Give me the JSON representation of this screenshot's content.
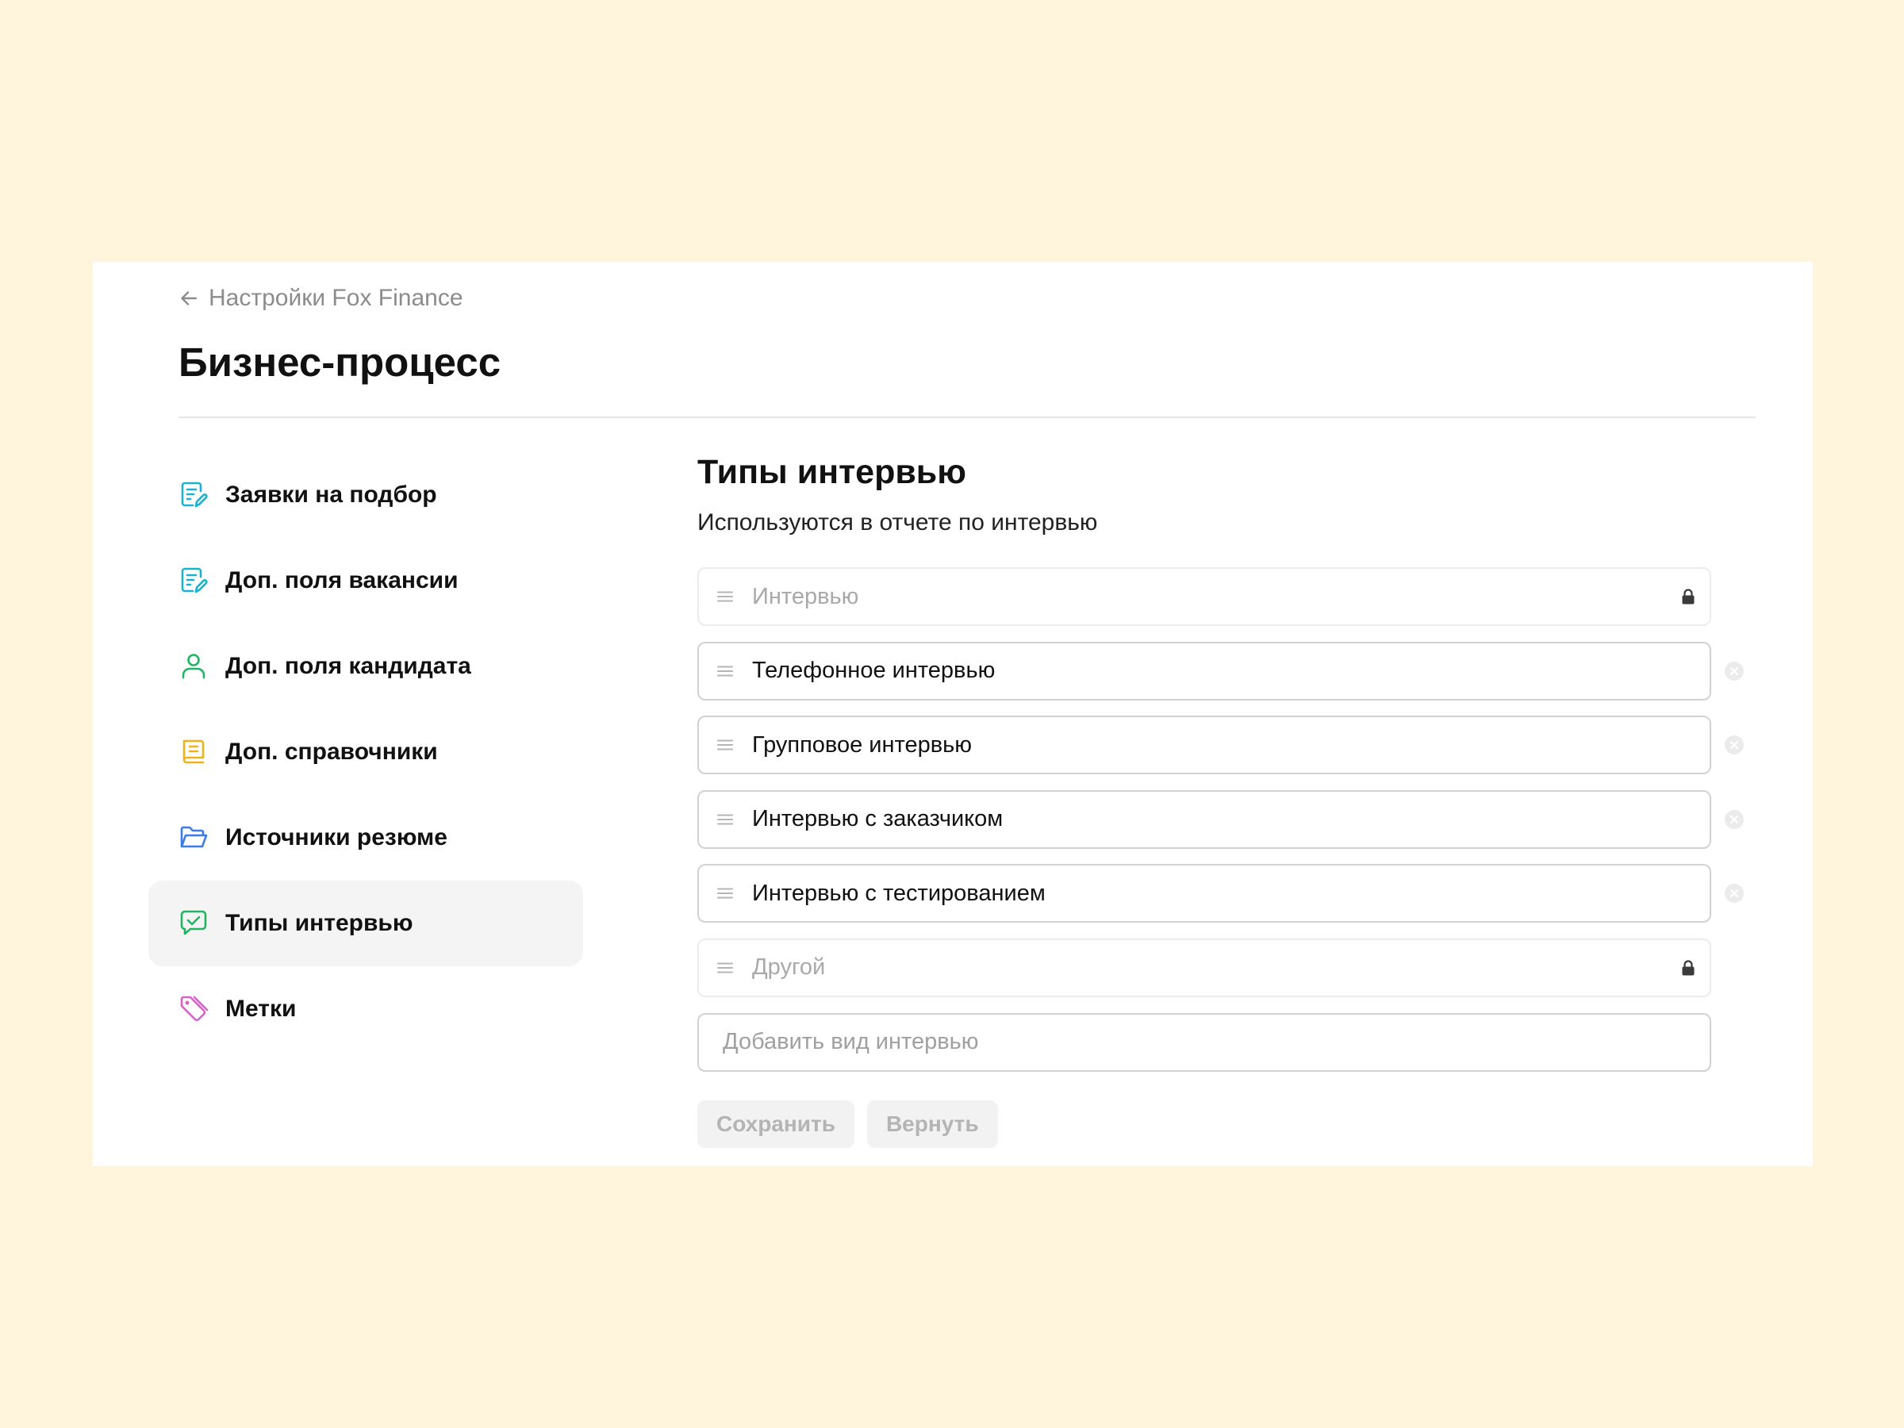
{
  "breadcrumb": {
    "label": "Настройки Fox Finance",
    "icon": "arrow-left-icon"
  },
  "page": {
    "title": "Бизнес-процесс"
  },
  "sidebar": {
    "items": [
      {
        "label": "Заявки на подбор",
        "icon": "document-edit-icon",
        "color": "#1ab3cf",
        "active": false
      },
      {
        "label": "Доп. поля вакансии",
        "icon": "document-edit-icon",
        "color": "#1ab3cf",
        "active": false
      },
      {
        "label": "Доп. поля кандидата",
        "icon": "user-icon",
        "color": "#21b462",
        "active": false
      },
      {
        "label": "Доп. справочники",
        "icon": "list-book-icon",
        "color": "#f0b11a",
        "active": false
      },
      {
        "label": "Источники резюме",
        "icon": "folder-icon",
        "color": "#3b7be8",
        "active": false
      },
      {
        "label": "Типы интервью",
        "icon": "chat-check-icon",
        "color": "#21b462",
        "active": true
      },
      {
        "label": "Метки",
        "icon": "tag-icon",
        "color": "#d562c8",
        "active": false
      }
    ]
  },
  "content": {
    "title": "Типы интервью",
    "subtitle": "Используются в отчете по интервью",
    "items": [
      {
        "value": "Интервью",
        "locked": true
      },
      {
        "value": "Телефонное интервью",
        "locked": false
      },
      {
        "value": "Групповое интервью",
        "locked": false
      },
      {
        "value": "Интервью с заказчиком",
        "locked": false
      },
      {
        "value": "Интервью с тестированием",
        "locked": false
      },
      {
        "value": "Другой",
        "locked": true
      }
    ],
    "add_placeholder": "Добавить вид интервью",
    "save_label": "Сохранить",
    "revert_label": "Вернуть"
  },
  "colors": {
    "background": "#fef5dc",
    "card": "#ffffff",
    "active_item": "#f4f4f4",
    "muted_text": "#8c8c8c",
    "button_bg": "#f2f2f2",
    "button_text": "#b4b4b4"
  }
}
